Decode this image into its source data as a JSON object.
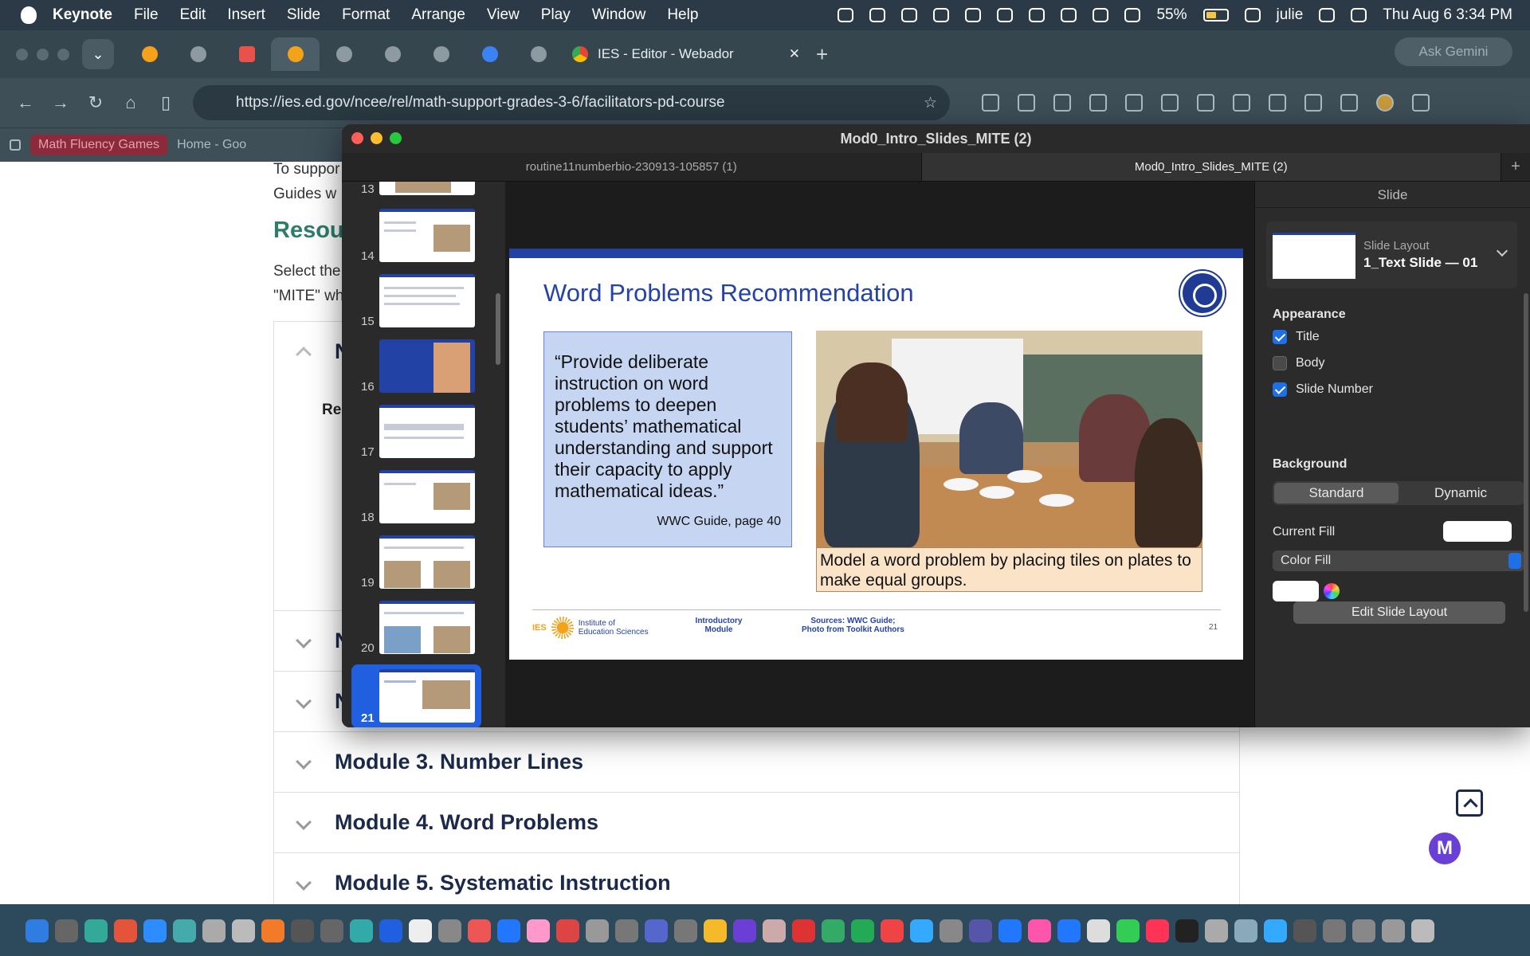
{
  "menubar": {
    "app_name": "Keynote",
    "menus": [
      "File",
      "Edit",
      "Insert",
      "Slide",
      "Format",
      "Arrange",
      "View",
      "Play",
      "Window",
      "Help"
    ],
    "battery_percent": "55%",
    "user": "julie",
    "datetime": "Thu Aug 6  3:34 PM"
  },
  "browser": {
    "active_tab_title": "IES - Editor - Webador",
    "ask_gemini": "Ask Gemini",
    "url": "https://ies.ed.gov/ncee/rel/math-support-grades-3-6/facilitators-pd-course",
    "bookmarks": [
      "Math Fluency Games",
      "Home - Goo"
    ]
  },
  "webpage": {
    "intro_line1": "To suppor",
    "intro_line2": "Guides w",
    "resources_heading": "Resou",
    "select_line1": "Select the",
    "select_line2": "\"MITE\" wh",
    "open_module_heading": "N",
    "open_module_body": "Re",
    "collapsed_partial": [
      "N",
      "N"
    ],
    "modules": [
      "Module 3. Number Lines",
      "Module 4. Word Problems",
      "Module 5. Systematic Instruction"
    ]
  },
  "keynote": {
    "window_title": "Mod0_Intro_Slides_MITE (2)",
    "tabs": [
      "routine11numberbio-230913-105857 (1)",
      "Mod0_Intro_Slides_MITE (2)"
    ],
    "slide_numbers": [
      "13",
      "14",
      "15",
      "16",
      "17",
      "18",
      "19",
      "20",
      "21"
    ],
    "selected_slide": "21",
    "slide": {
      "title": "Word Problems Recommendation",
      "quote": "“Provide deliberate instruction on word problems to deepen students’ mathematical understanding and support their capacity to apply mathematical ideas.”",
      "quote_source": "WWC Guide, page 40",
      "photo_caption": "Model a word problem by placing tiles on plates to make equal groups.",
      "footer_ies": "IES",
      "footer_institute": "Institute of\nEducation Sciences",
      "footer_module": "Introductory Module",
      "footer_sources": "Sources: WWC Guide;\nPhoto from Toolkit Authors",
      "footer_number": "21"
    },
    "inspector": {
      "header": "Slide",
      "layout_label": "Slide Layout",
      "layout_value": "1_Text Slide — 01",
      "appearance_heading": "Appearance",
      "checkboxes": [
        {
          "label": "Title",
          "checked": true
        },
        {
          "label": "Body",
          "checked": false
        },
        {
          "label": "Slide Number",
          "checked": true
        }
      ],
      "background_heading": "Background",
      "segments": [
        "Standard",
        "Dynamic"
      ],
      "active_segment": "Standard",
      "current_fill_label": "Current Fill",
      "fill_type": "Color Fill",
      "edit_layout_button": "Edit Slide Layout"
    }
  },
  "colors": {
    "slide_blue": "#2341a4",
    "quote_bg": "#c6d6f2",
    "caption_bg": "#fbe3c8",
    "selection_blue": "#1f5fe0",
    "module_heading": "#1b2a4a"
  }
}
